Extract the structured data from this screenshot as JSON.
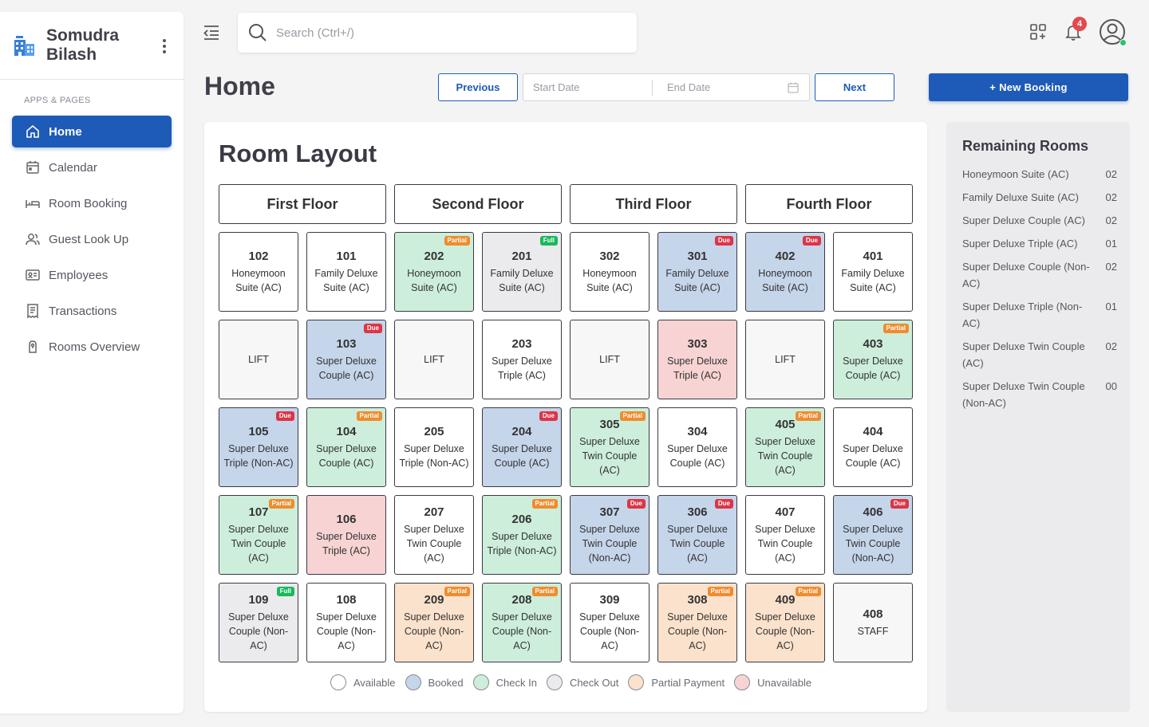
{
  "brand": {
    "name": "Somudra Bilash"
  },
  "sidebar": {
    "section_label": "APPS & PAGES",
    "items": [
      {
        "label": "Home",
        "icon": "home-icon",
        "active": true
      },
      {
        "label": "Calendar",
        "icon": "calendar-icon"
      },
      {
        "label": "Room Booking",
        "icon": "bed-icon"
      },
      {
        "label": "Guest Look Up",
        "icon": "users-icon"
      },
      {
        "label": "Employees",
        "icon": "id-card-icon"
      },
      {
        "label": "Transactions",
        "icon": "receipt-icon"
      },
      {
        "label": "Rooms Overview",
        "icon": "key-icon"
      }
    ]
  },
  "header": {
    "search_placeholder": "Search (Ctrl+/)",
    "notification_count": "4"
  },
  "toolbar": {
    "page_title": "Home",
    "previous_label": "Previous",
    "start_date_placeholder": "Start Date",
    "end_date_placeholder": "End Date",
    "next_label": "Next",
    "new_booking_label": "+ New Booking"
  },
  "layout": {
    "title": "Room Layout",
    "floors": [
      "First Floor",
      "Second Floor",
      "Third Floor",
      "Fourth Floor"
    ],
    "rooms": [
      {
        "no": "102",
        "type": "Honeymoon Suite (AC)",
        "status": "available"
      },
      {
        "no": "101",
        "type": "Family Deluxe Suite (AC)",
        "status": "available"
      },
      {
        "no": "202",
        "type": "Honeymoon Suite (AC)",
        "status": "checkin",
        "badge": "Partial"
      },
      {
        "no": "201",
        "type": "Family Deluxe Suite (AC)",
        "status": "checkout",
        "badge": "Full"
      },
      {
        "no": "302",
        "type": "Honeymoon Suite (AC)",
        "status": "available"
      },
      {
        "no": "301",
        "type": "Family Deluxe Suite (AC)",
        "status": "booked",
        "badge": "Due"
      },
      {
        "no": "402",
        "type": "Honeymoon Suite (AC)",
        "status": "booked",
        "badge": "Due"
      },
      {
        "no": "401",
        "type": "Family Deluxe Suite (AC)",
        "status": "available"
      },
      {
        "no": "",
        "type": "LIFT",
        "status": "lift"
      },
      {
        "no": "103",
        "type": "Super Deluxe Couple (AC)",
        "status": "booked",
        "badge": "Due"
      },
      {
        "no": "",
        "type": "LIFT",
        "status": "lift"
      },
      {
        "no": "203",
        "type": "Super Deluxe Triple (AC)",
        "status": "available"
      },
      {
        "no": "",
        "type": "LIFT",
        "status": "lift"
      },
      {
        "no": "303",
        "type": "Super Deluxe Triple (AC)",
        "status": "unavailable"
      },
      {
        "no": "",
        "type": "LIFT",
        "status": "lift"
      },
      {
        "no": "403",
        "type": "Super Deluxe Couple (AC)",
        "status": "checkin",
        "badge": "Partial"
      },
      {
        "no": "105",
        "type": "Super Deluxe Triple (Non-AC)",
        "status": "booked",
        "badge": "Due"
      },
      {
        "no": "104",
        "type": "Super Deluxe Couple (AC)",
        "status": "checkin",
        "badge": "Partial"
      },
      {
        "no": "205",
        "type": "Super Deluxe Triple (Non-AC)",
        "status": "available"
      },
      {
        "no": "204",
        "type": "Super Deluxe Couple (AC)",
        "status": "booked",
        "badge": "Due"
      },
      {
        "no": "305",
        "type": "Super Deluxe Twin Couple (AC)",
        "status": "checkin",
        "badge": "Partial"
      },
      {
        "no": "304",
        "type": "Super Deluxe Couple (AC)",
        "status": "available"
      },
      {
        "no": "405",
        "type": "Super Deluxe Twin Couple (AC)",
        "status": "checkin",
        "badge": "Partial"
      },
      {
        "no": "404",
        "type": "Super Deluxe Couple (AC)",
        "status": "available"
      },
      {
        "no": "107",
        "type": "Super Deluxe Twin Couple (AC)",
        "status": "checkin",
        "badge": "Partial"
      },
      {
        "no": "106",
        "type": "Super Deluxe Triple (AC)",
        "status": "unavailable"
      },
      {
        "no": "207",
        "type": "Super Deluxe Twin Couple (AC)",
        "status": "available"
      },
      {
        "no": "206",
        "type": "Super Deluxe Triple (Non-AC)",
        "status": "checkin",
        "badge": "Partial"
      },
      {
        "no": "307",
        "type": "Super Deluxe Twin Couple (Non-AC)",
        "status": "booked",
        "badge": "Due"
      },
      {
        "no": "306",
        "type": "Super Deluxe Twin Couple (AC)",
        "status": "booked",
        "badge": "Due"
      },
      {
        "no": "407",
        "type": "Super Deluxe Twin Couple (AC)",
        "status": "available"
      },
      {
        "no": "406",
        "type": "Super Deluxe Twin Couple (Non-AC)",
        "status": "booked",
        "badge": "Due"
      },
      {
        "no": "109",
        "type": "Super Deluxe Couple (Non-AC)",
        "status": "checkout",
        "badge": "Full"
      },
      {
        "no": "108",
        "type": "Super Deluxe Couple (Non-AC)",
        "status": "available"
      },
      {
        "no": "209",
        "type": "Super Deluxe Couple (Non-AC)",
        "status": "partial",
        "badge": "Partial"
      },
      {
        "no": "208",
        "type": "Super Deluxe Couple (Non-AC)",
        "status": "checkin",
        "badge": "Partial"
      },
      {
        "no": "309",
        "type": "Super Deluxe Couple (Non-AC)",
        "status": "available"
      },
      {
        "no": "308",
        "type": "Super Deluxe Couple (Non-AC)",
        "status": "partial",
        "badge": "Partial"
      },
      {
        "no": "409",
        "type": "Super Deluxe Couple (Non-AC)",
        "status": "partial",
        "badge": "Partial"
      },
      {
        "no": "408",
        "type": "STAFF",
        "status": "lift"
      }
    ],
    "legend": [
      {
        "label": "Available",
        "color": "#ffffff"
      },
      {
        "label": "Booked",
        "color": "#c5d5ea"
      },
      {
        "label": "Check In",
        "color": "#cdeedb"
      },
      {
        "label": "Check Out",
        "color": "#ebebee"
      },
      {
        "label": "Partial Payment",
        "color": "#fbe2cc"
      },
      {
        "label": "Unavailable",
        "color": "#f7d3d4"
      }
    ]
  },
  "remaining": {
    "title": "Remaining Rooms",
    "items": [
      {
        "name": "Honeymoon Suite (AC)",
        "count": "02"
      },
      {
        "name": "Family Deluxe Suite (AC)",
        "count": "02"
      },
      {
        "name": "Super Deluxe Couple (AC)",
        "count": "02"
      },
      {
        "name": "Super Deluxe Triple (AC)",
        "count": "01"
      },
      {
        "name": "Super Deluxe Couple (Non-AC)",
        "count": "02"
      },
      {
        "name": "Super Deluxe Triple (Non-AC)",
        "count": "01"
      },
      {
        "name": "Super Deluxe Twin Couple (AC)",
        "count": "02"
      },
      {
        "name": "Super Deluxe Twin Couple (Non-AC)",
        "count": "00"
      }
    ]
  },
  "colors": {
    "accent": "#1e5bb8",
    "badge_due": "#dc3545",
    "badge_partial": "#f08c2e",
    "badge_full": "#1ab85c"
  }
}
